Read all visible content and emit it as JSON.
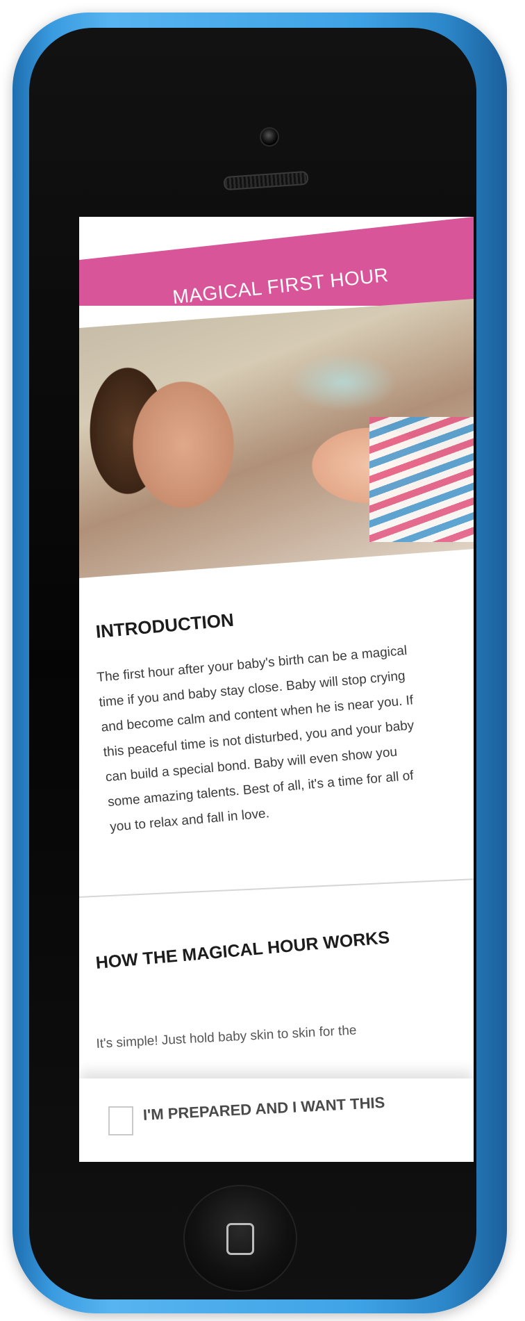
{
  "app": {
    "title": "MAGICAL FIRST HOUR",
    "back_icon": "chevron-left-icon",
    "accent_color": "#d9559a",
    "device_case_color": "#3ea3e6"
  },
  "article": {
    "intro": {
      "heading": "INTRODUCTION",
      "body": "The first hour after your baby's birth can be a magical time if you and baby stay close. Baby will stop crying and become calm and content when he is near you. If this peaceful time is not disturbed, you and your baby can build a special bond. Baby will even show you some amazing talents. Best of all, it's a time for all of you to relax and fall in love."
    },
    "how": {
      "heading": "HOW THE MAGICAL HOUR WORKS",
      "body_preview": "It's simple! Just hold baby skin to skin for the"
    }
  },
  "footer": {
    "checkbox_label": "I'M PREPARED AND I WANT THIS",
    "checked": false
  }
}
